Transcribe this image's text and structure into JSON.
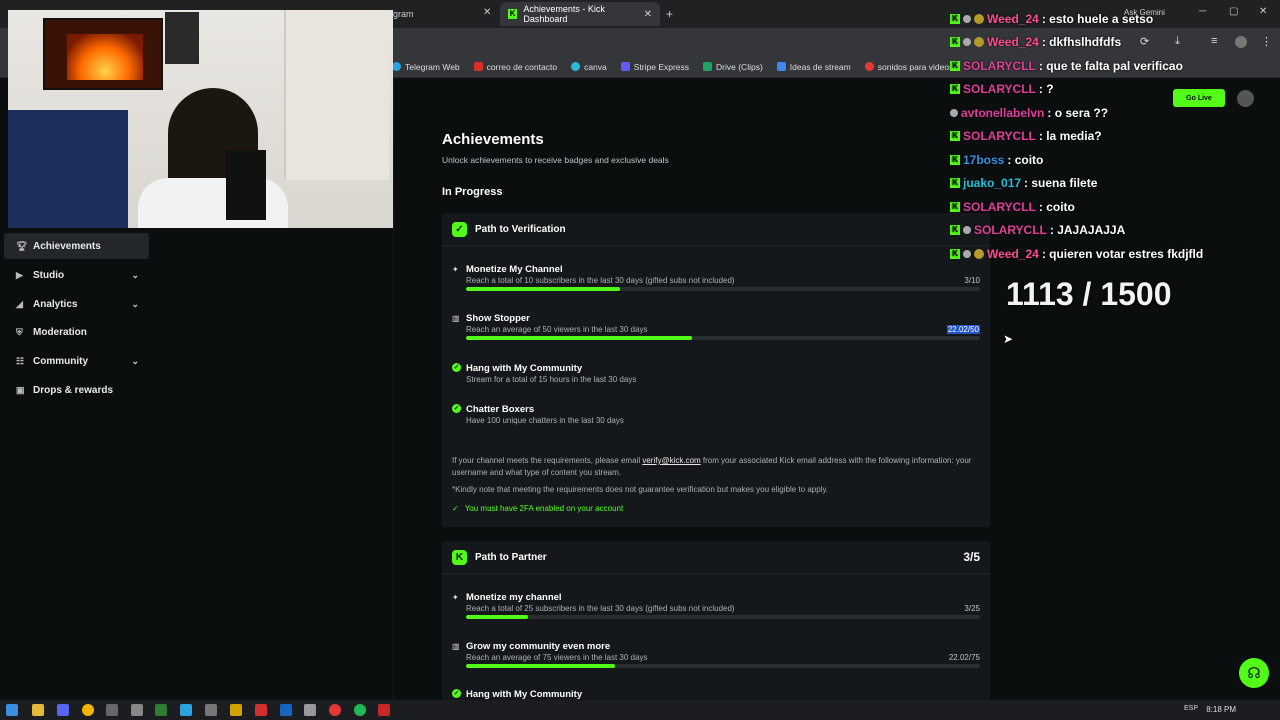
{
  "browser": {
    "tab_left_partial": "gram",
    "tab_active": "Achievements - Kick Dashboard",
    "ask_gemini": "Ask Gemini",
    "bookmarks": [
      {
        "label": "Telegram Web",
        "color": "#2aa3e0"
      },
      {
        "label": "correo de contacto",
        "color": "#d93025"
      },
      {
        "label": "canva",
        "color": "#2bbbd8"
      },
      {
        "label": "Stripe Express",
        "color": "#635bff"
      },
      {
        "label": "Drive (Clips)",
        "color": "#1fa463"
      },
      {
        "label": "Ideas de stream",
        "color": "#4285f4"
      },
      {
        "label": "sonidos para videos",
        "color": "#e53935"
      }
    ]
  },
  "sidebar": {
    "items": [
      {
        "label": "Achievements",
        "icon": "trophy-icon",
        "expandable": false
      },
      {
        "label": "Studio",
        "icon": "play-icon",
        "expandable": true
      },
      {
        "label": "Analytics",
        "icon": "chart-icon",
        "expandable": true
      },
      {
        "label": "Moderation",
        "icon": "shield-icon",
        "expandable": false
      },
      {
        "label": "Community",
        "icon": "people-icon",
        "expandable": true
      },
      {
        "label": "Drops & rewards",
        "icon": "gift-icon",
        "expandable": false
      }
    ]
  },
  "main": {
    "title": "Achievements",
    "subtitle": "Unlock achievements to receive badges and exclusive deals",
    "section": "In Progress",
    "verification": {
      "title": "Path to Verification",
      "requirements": [
        {
          "title": "Monetize My Channel",
          "desc": "Reach a total of 10 subscribers in the last 30 days (gifted subs not included)",
          "value": "3/10",
          "progress": 0.3
        },
        {
          "title": "Show Stopper",
          "desc": "Reach an average of 50 viewers in the last 30 days",
          "value": "22.02/50",
          "progress": 0.44
        },
        {
          "title": "Hang with My Community",
          "desc": "Stream for a total of 15 hours in the last 30 days"
        },
        {
          "title": "Chatter Boxers",
          "desc": "Have 100 unique chatters in the last 30 days"
        }
      ],
      "note_prefix": "If your channel meets the requirements, please email ",
      "note_email": "verify@kick.com",
      "note_suffix": " from your associated Kick email address with the following information: your username and what type of content you stream.",
      "note2": "*Kindly note that meeting the requirements does not guarantee verification but makes you eligible to apply.",
      "twofa": "You must have 2FA enabled on your account"
    },
    "partner": {
      "title": "Path to Partner",
      "count": "3/5",
      "requirements": [
        {
          "title": "Monetize my channel",
          "desc": "Reach a total of 25 subscribers in the last 30 days (gifted subs not included)",
          "value": "3/25",
          "progress": 0.12
        },
        {
          "title": "Grow my community even more",
          "desc": "Reach an average of 75 viewers in the last 30 days",
          "value": "22.02/75",
          "progress": 0.29
        },
        {
          "title": "Hang with My Community"
        }
      ]
    }
  },
  "topbar": {
    "go_live": "Go Live"
  },
  "chat": [
    {
      "user": "Weed_24",
      "color": "#ff4d8d",
      "msg": ": esto huele a setso",
      "badges": [
        "k",
        "b1",
        "b2"
      ]
    },
    {
      "user": "Weed_24",
      "color": "#ff4d8d",
      "msg": ": dkfhslhdfdfs",
      "badges": [
        "k",
        "b1",
        "b2"
      ]
    },
    {
      "user": "SOLARYCLL",
      "color": "#e0409a",
      "msg": ": que te falta pal verificao",
      "badges": [
        "k"
      ]
    },
    {
      "user": "SOLARYCLL",
      "color": "#e0409a",
      "msg": ": ?",
      "badges": [
        "k"
      ]
    },
    {
      "user": "avtonellabelvn",
      "color": "#e0409a",
      "msg": ": o sera ??",
      "badges": [
        "b1"
      ]
    },
    {
      "user": "SOLARYCLL",
      "color": "#e0409a",
      "msg": ": la media?",
      "badges": [
        "k"
      ]
    },
    {
      "user": "17boss",
      "color": "#3b8fe0",
      "msg": ": coito",
      "badges": [
        "k"
      ]
    },
    {
      "user": "juako_017",
      "color": "#22c0d8",
      "msg": ": suena filete",
      "badges": [
        "k"
      ]
    },
    {
      "user": "SOLARYCLL",
      "color": "#e0409a",
      "msg": ": coito",
      "badges": [
        "k"
      ]
    },
    {
      "user": "SOLARYCLL",
      "color": "#e0409a",
      "msg": ": JAJAJAJJA",
      "badges": [
        "k",
        "b1"
      ]
    },
    {
      "user": "Weed_24",
      "color": "#ff4d8d",
      "msg": ": quieren votar estres fkdjfld",
      "badges": [
        "k",
        "b1",
        "b2"
      ]
    }
  ],
  "counter": "1113 / 1500",
  "taskbar": {
    "lang": "ESP",
    "time": "8:18 PM"
  }
}
